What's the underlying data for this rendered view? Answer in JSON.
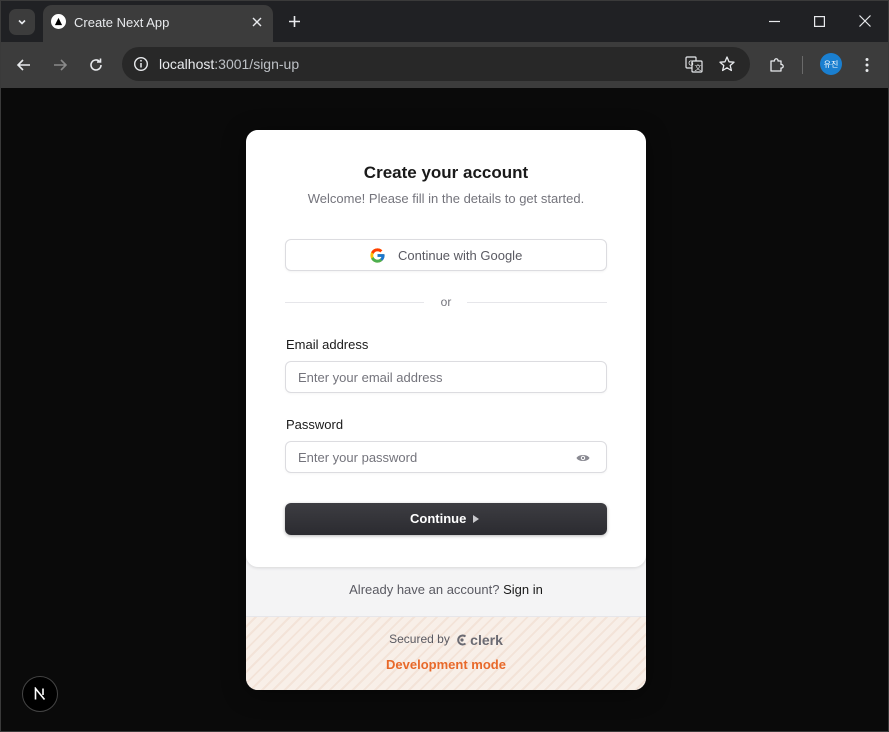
{
  "browser": {
    "tab_title": "Create Next App",
    "url_host": "localhost",
    "url_path": ":3001/sign-up",
    "profile_initials": "유진"
  },
  "signup": {
    "title": "Create your account",
    "subtitle": "Welcome! Please fill in the details to get started.",
    "google_label": "Continue with Google",
    "divider": "or",
    "email_label": "Email address",
    "email_placeholder": "Enter your email address",
    "password_label": "Password",
    "password_placeholder": "Enter your password",
    "continue_label": "Continue",
    "signin_prompt": "Already have an account?",
    "signin_link": "Sign in",
    "secured_by": "Secured by",
    "clerk_brand": "clerk",
    "dev_mode": "Development mode"
  },
  "colors": {
    "dev_mode": "#e8692a",
    "profile": "#1a7fd0",
    "button_dark": "#2f2f34"
  }
}
